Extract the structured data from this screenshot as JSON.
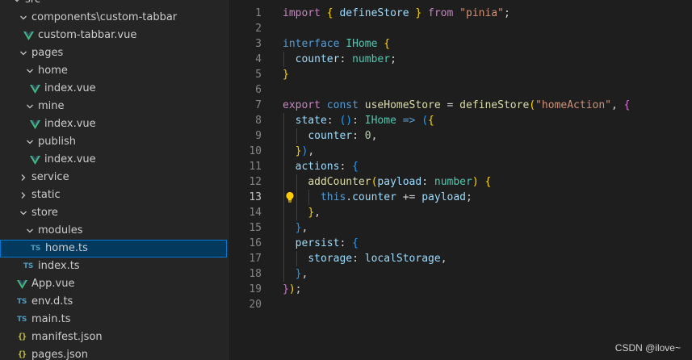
{
  "explorer": {
    "rows": [
      {
        "label": "src",
        "kind": "folder",
        "open": true,
        "depth": 0,
        "icon": "chevron-down-icon"
      },
      {
        "label": "components\\custom-tabbar",
        "kind": "folder",
        "open": true,
        "depth": 1,
        "icon": "chevron-down-icon"
      },
      {
        "label": "custom-tabbar.vue",
        "kind": "vue",
        "depth": 2,
        "icon": "vue-file-icon"
      },
      {
        "label": "pages",
        "kind": "folder",
        "open": true,
        "depth": 1,
        "icon": "chevron-down-icon"
      },
      {
        "label": "home",
        "kind": "folder",
        "open": true,
        "depth": 2,
        "icon": "chevron-down-icon"
      },
      {
        "label": "index.vue",
        "kind": "vue",
        "depth": 3,
        "icon": "vue-file-icon"
      },
      {
        "label": "mine",
        "kind": "folder",
        "open": true,
        "depth": 2,
        "icon": "chevron-down-icon"
      },
      {
        "label": "index.vue",
        "kind": "vue",
        "depth": 3,
        "icon": "vue-file-icon"
      },
      {
        "label": "publish",
        "kind": "folder",
        "open": true,
        "depth": 2,
        "icon": "chevron-down-icon"
      },
      {
        "label": "index.vue",
        "kind": "vue",
        "depth": 3,
        "icon": "vue-file-icon"
      },
      {
        "label": "service",
        "kind": "folder",
        "open": false,
        "depth": 1,
        "icon": "chevron-right-icon"
      },
      {
        "label": "static",
        "kind": "folder",
        "open": false,
        "depth": 1,
        "icon": "chevron-right-icon"
      },
      {
        "label": "store",
        "kind": "folder",
        "open": true,
        "depth": 1,
        "icon": "chevron-down-icon"
      },
      {
        "label": "modules",
        "kind": "folder",
        "open": true,
        "depth": 2,
        "icon": "chevron-down-icon"
      },
      {
        "label": "home.ts",
        "kind": "ts",
        "depth": 3,
        "icon": "ts-file-icon",
        "selected": true
      },
      {
        "label": "index.ts",
        "kind": "ts",
        "depth": 2,
        "icon": "ts-file-icon"
      },
      {
        "label": "App.vue",
        "kind": "vue",
        "depth": 1,
        "icon": "vue-file-icon"
      },
      {
        "label": "env.d.ts",
        "kind": "ts",
        "depth": 1,
        "icon": "ts-file-icon"
      },
      {
        "label": "main.ts",
        "kind": "ts",
        "depth": 1,
        "icon": "ts-file-icon"
      },
      {
        "label": "manifest.json",
        "kind": "json",
        "depth": 1,
        "icon": "json-file-icon"
      },
      {
        "label": "pages.json",
        "kind": "json",
        "depth": 1,
        "icon": "json-file-icon"
      }
    ],
    "badges": {
      "ts": "TS",
      "json": "{}"
    }
  },
  "editor": {
    "active_line": 13,
    "lines": [
      {
        "n": "1",
        "tokens": [
          [
            "k",
            "import"
          ],
          [
            "p",
            " "
          ],
          [
            "b1",
            "{"
          ],
          [
            "p",
            " "
          ],
          [
            "v",
            "defineStore"
          ],
          [
            "p",
            " "
          ],
          [
            "b1",
            "}"
          ],
          [
            "p",
            " "
          ],
          [
            "k",
            "from"
          ],
          [
            "p",
            " "
          ],
          [
            "s",
            "\"pinia\""
          ],
          [
            "p",
            ";"
          ]
        ]
      },
      {
        "n": "2",
        "tokens": []
      },
      {
        "n": "3",
        "tokens": [
          [
            "kb",
            "interface"
          ],
          [
            "p",
            " "
          ],
          [
            "t",
            "IHome"
          ],
          [
            "p",
            " "
          ],
          [
            "b1",
            "{"
          ]
        ]
      },
      {
        "n": "4",
        "tokens": [
          [
            "p",
            "  "
          ],
          [
            "v",
            "counter"
          ],
          [
            "p",
            ": "
          ],
          [
            "t",
            "number"
          ],
          [
            "p",
            ";"
          ]
        ]
      },
      {
        "n": "5",
        "tokens": [
          [
            "b1",
            "}"
          ]
        ]
      },
      {
        "n": "6",
        "tokens": []
      },
      {
        "n": "7",
        "tokens": [
          [
            "k",
            "export"
          ],
          [
            "p",
            " "
          ],
          [
            "kb",
            "const"
          ],
          [
            "p",
            " "
          ],
          [
            "f",
            "useHomeStore"
          ],
          [
            "p",
            " = "
          ],
          [
            "f",
            "defineStore"
          ],
          [
            "b1",
            "("
          ],
          [
            "s",
            "\"homeAction\""
          ],
          [
            "p",
            ", "
          ],
          [
            "b2",
            "{"
          ]
        ]
      },
      {
        "n": "8",
        "tokens": [
          [
            "p",
            "  "
          ],
          [
            "v",
            "state"
          ],
          [
            "p",
            ": "
          ],
          [
            "b3",
            "()"
          ],
          [
            "p",
            ": "
          ],
          [
            "t",
            "IHome"
          ],
          [
            "p",
            " "
          ],
          [
            "kb",
            "=>"
          ],
          [
            "p",
            " "
          ],
          [
            "b3",
            "("
          ],
          [
            "b1",
            "{"
          ]
        ]
      },
      {
        "n": "9",
        "tokens": [
          [
            "p",
            "    "
          ],
          [
            "v",
            "counter"
          ],
          [
            "p",
            ": "
          ],
          [
            "n",
            "0"
          ],
          [
            "p",
            ","
          ]
        ]
      },
      {
        "n": "10",
        "tokens": [
          [
            "p",
            "  "
          ],
          [
            "b1",
            "}"
          ],
          [
            "b3",
            ")"
          ],
          [
            "p",
            ","
          ]
        ]
      },
      {
        "n": "11",
        "tokens": [
          [
            "p",
            "  "
          ],
          [
            "v",
            "actions"
          ],
          [
            "p",
            ": "
          ],
          [
            "b3",
            "{"
          ]
        ]
      },
      {
        "n": "12",
        "tokens": [
          [
            "p",
            "    "
          ],
          [
            "f",
            "addCounter"
          ],
          [
            "b1",
            "("
          ],
          [
            "v",
            "payload"
          ],
          [
            "p",
            ": "
          ],
          [
            "t",
            "number"
          ],
          [
            "b1",
            ")"
          ],
          [
            "p",
            " "
          ],
          [
            "b1",
            "{"
          ]
        ]
      },
      {
        "n": "13",
        "tokens": [
          [
            "p",
            "      "
          ],
          [
            "kb",
            "this"
          ],
          [
            "p",
            "."
          ],
          [
            "v",
            "counter"
          ],
          [
            "p",
            " += "
          ],
          [
            "v",
            "payload"
          ],
          [
            "p",
            ";"
          ]
        ]
      },
      {
        "n": "14",
        "tokens": [
          [
            "p",
            "    "
          ],
          [
            "b1",
            "}"
          ],
          [
            "p",
            ","
          ]
        ]
      },
      {
        "n": "15",
        "tokens": [
          [
            "p",
            "  "
          ],
          [
            "b3",
            "}"
          ],
          [
            "p",
            ","
          ]
        ]
      },
      {
        "n": "16",
        "tokens": [
          [
            "p",
            "  "
          ],
          [
            "v",
            "persist"
          ],
          [
            "p",
            ": "
          ],
          [
            "b3",
            "{"
          ]
        ]
      },
      {
        "n": "17",
        "tokens": [
          [
            "p",
            "    "
          ],
          [
            "v",
            "storage"
          ],
          [
            "p",
            ": "
          ],
          [
            "v",
            "localStorage"
          ],
          [
            "p",
            ","
          ]
        ]
      },
      {
        "n": "18",
        "tokens": [
          [
            "p",
            "  "
          ],
          [
            "b3",
            "}"
          ],
          [
            "p",
            ","
          ]
        ]
      },
      {
        "n": "19",
        "tokens": [
          [
            "b2",
            "}"
          ],
          [
            "b1",
            ")"
          ],
          [
            "p",
            ";"
          ]
        ]
      },
      {
        "n": "20",
        "tokens": []
      }
    ]
  },
  "watermark": "CSDN @ilove~",
  "colors": {
    "vue": "#41b883",
    "ts": "#519aba",
    "json": "#cbcb41",
    "selection_bg": "#04395e",
    "selection_border": "#0078d4",
    "bulb": "#ffcc00"
  }
}
